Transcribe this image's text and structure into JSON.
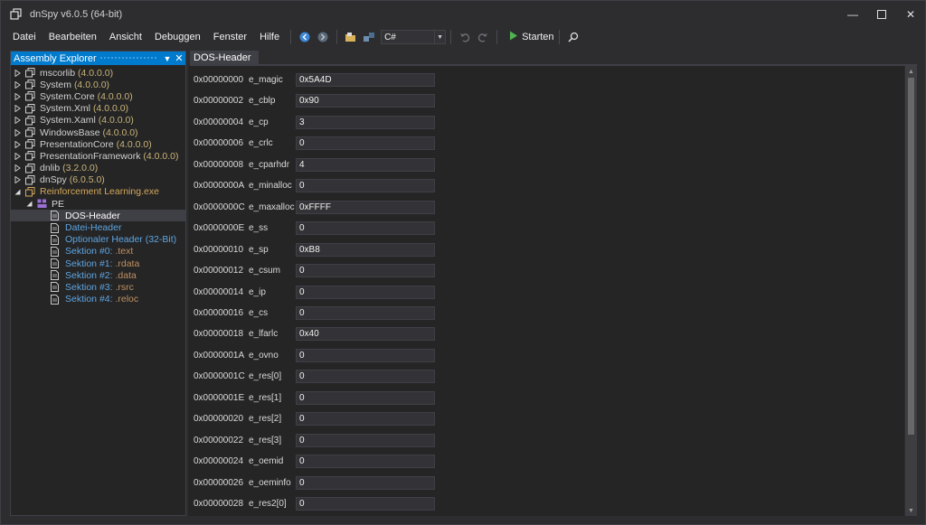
{
  "window": {
    "title": "dnSpy v6.0.5 (64-bit)",
    "controls": {
      "minimize": "—",
      "maximize": "■",
      "close": "✕"
    }
  },
  "menu": [
    "Datei",
    "Bearbeiten",
    "Ansicht",
    "Debuggen",
    "Fenster",
    "Hilfe"
  ],
  "toolbar": {
    "language": "C#",
    "start_label": "Starten",
    "icons": [
      "back-icon",
      "forward-icon",
      "open-folder-icon",
      "open-list-icon",
      "undo-icon",
      "redo-icon",
      "play-icon",
      "search-icon"
    ]
  },
  "assembly_explorer": {
    "title": "Assembly Explorer",
    "dropdown_glyph": "▼",
    "close_glyph": "✕",
    "items": [
      {
        "name": "mscorlib",
        "version": "(4.0.0.0)"
      },
      {
        "name": "System",
        "version": "(4.0.0.0)"
      },
      {
        "name": "System.Core",
        "version": "(4.0.0.0)"
      },
      {
        "name": "System.Xml",
        "version": "(4.0.0.0)"
      },
      {
        "name": "System.Xaml",
        "version": "(4.0.0.0)"
      },
      {
        "name": "WindowsBase",
        "version": "(4.0.0.0)"
      },
      {
        "name": "PresentationCore",
        "version": "(4.0.0.0)"
      },
      {
        "name": "PresentationFramework",
        "version": "(4.0.0.0)"
      },
      {
        "name": "dnlib",
        "version": "(3.2.0.0)"
      },
      {
        "name": "dnSpy",
        "version": "(6.0.5.0)"
      }
    ],
    "exe": "Reinforcement Learning.exe",
    "pe_label": "PE",
    "pe_children": [
      {
        "label": "DOS-Header",
        "kind": "hdr",
        "selected": true
      },
      {
        "label": "Datei-Header",
        "kind": "hdr"
      },
      {
        "label": "Optionaler Header (32-Bit)",
        "kind": "hdr"
      },
      {
        "label": "Sektion #0:",
        "section": ".text",
        "kind": "sect"
      },
      {
        "label": "Sektion #1:",
        "section": ".rdata",
        "kind": "sect"
      },
      {
        "label": "Sektion #2:",
        "section": ".data",
        "kind": "sect"
      },
      {
        "label": "Sektion #3:",
        "section": ".rsrc",
        "kind": "sect"
      },
      {
        "label": "Sektion #4:",
        "section": ".reloc",
        "kind": "sect"
      }
    ]
  },
  "document_tab": {
    "label": "DOS-Header"
  },
  "dos_header_fields": [
    {
      "offset": "0x00000000",
      "name": "e_magic",
      "value": "0x5A4D"
    },
    {
      "offset": "0x00000002",
      "name": "e_cblp",
      "value": "0x90"
    },
    {
      "offset": "0x00000004",
      "name": "e_cp",
      "value": "3"
    },
    {
      "offset": "0x00000006",
      "name": "e_crlc",
      "value": "0"
    },
    {
      "offset": "0x00000008",
      "name": "e_cparhdr",
      "value": "4"
    },
    {
      "offset": "0x0000000A",
      "name": "e_minalloc",
      "value": "0"
    },
    {
      "offset": "0x0000000C",
      "name": "e_maxalloc",
      "value": "0xFFFF"
    },
    {
      "offset": "0x0000000E",
      "name": "e_ss",
      "value": "0"
    },
    {
      "offset": "0x00000010",
      "name": "e_sp",
      "value": "0xB8"
    },
    {
      "offset": "0x00000012",
      "name": "e_csum",
      "value": "0"
    },
    {
      "offset": "0x00000014",
      "name": "e_ip",
      "value": "0"
    },
    {
      "offset": "0x00000016",
      "name": "e_cs",
      "value": "0"
    },
    {
      "offset": "0x00000018",
      "name": "e_lfarlc",
      "value": "0x40"
    },
    {
      "offset": "0x0000001A",
      "name": "e_ovno",
      "value": "0"
    },
    {
      "offset": "0x0000001C",
      "name": "e_res[0]",
      "value": "0"
    },
    {
      "offset": "0x0000001E",
      "name": "e_res[1]",
      "value": "0"
    },
    {
      "offset": "0x00000020",
      "name": "e_res[2]",
      "value": "0"
    },
    {
      "offset": "0x00000022",
      "name": "e_res[3]",
      "value": "0"
    },
    {
      "offset": "0x00000024",
      "name": "e_oemid",
      "value": "0"
    },
    {
      "offset": "0x00000026",
      "name": "e_oeminfo",
      "value": "0"
    },
    {
      "offset": "0x00000028",
      "name": "e_res2[0]",
      "value": "0"
    }
  ],
  "colors": {
    "accent": "#007acc",
    "background": "#2d2d30",
    "panel": "#252526",
    "version_text": "#c9b377",
    "header_link": "#5ea5e0",
    "exe_text": "#d4a85a",
    "section_name": "#c09060"
  }
}
